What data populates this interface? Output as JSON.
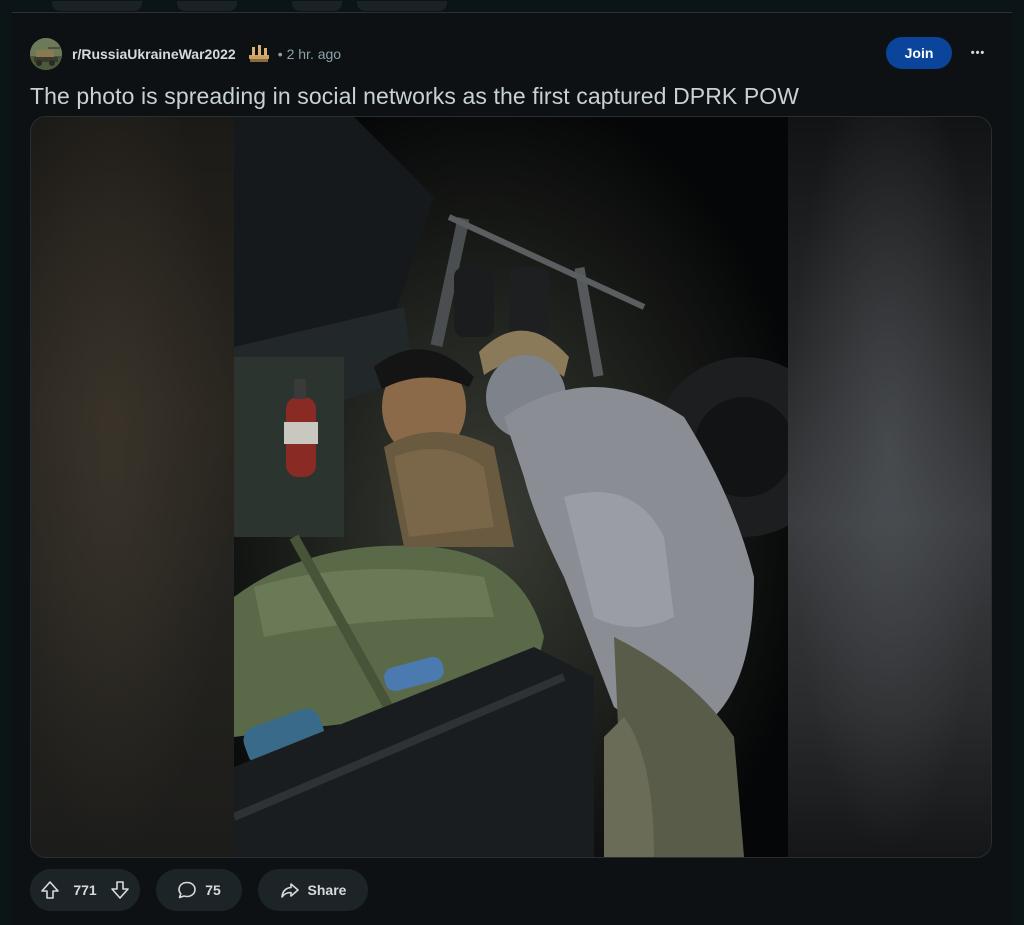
{
  "post": {
    "subreddit": "r/RussiaUkraineWar2022",
    "separator": "•",
    "time": "2 hr. ago",
    "join_label": "Join",
    "more_label": "•••",
    "title": "The photo is spreading in social networks as the first captured DPRK POW"
  },
  "actions": {
    "upvotes": "771",
    "comments": "75",
    "share_label": "Share"
  },
  "colors": {
    "background": "#0b1416",
    "join_button": "#0a449b",
    "pill": "#1d2427",
    "meta_text": "#8ba2ad"
  },
  "icons": {
    "upvote": "arrow-up-icon",
    "downvote": "arrow-down-icon",
    "comment": "speech-bubble-icon",
    "share": "share-arrow-icon",
    "more": "ellipsis-icon",
    "flair": "flair-icon"
  }
}
